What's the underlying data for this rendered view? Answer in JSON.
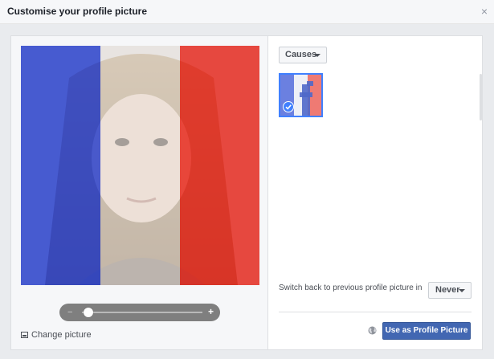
{
  "dialog": {
    "title": "Customise your profile picture",
    "close_icon": "close-icon",
    "close_glyph": "×"
  },
  "photo": {
    "overlay": "flag-tricolor",
    "colors": {
      "blue": "#2640d0",
      "white": "#f0f0f0",
      "red": "#e8281e"
    }
  },
  "zoom": {
    "minus_glyph": "−",
    "plus_glyph": "+",
    "level": 0.05
  },
  "change_picture": {
    "label": "Change picture",
    "icon": "picture-icon"
  },
  "frames": {
    "filter_label": "Causes",
    "selected_frame": {
      "icon": "facebook-flag-frame",
      "selected": true
    }
  },
  "revert": {
    "label": "Switch back to previous profile picture in",
    "value": "Never"
  },
  "actions": {
    "privacy_icon": "globe-icon",
    "primary_label": "Use as Profile Picture"
  },
  "colors": {
    "primary_button": "#4267b2",
    "selection": "#4080ff"
  }
}
